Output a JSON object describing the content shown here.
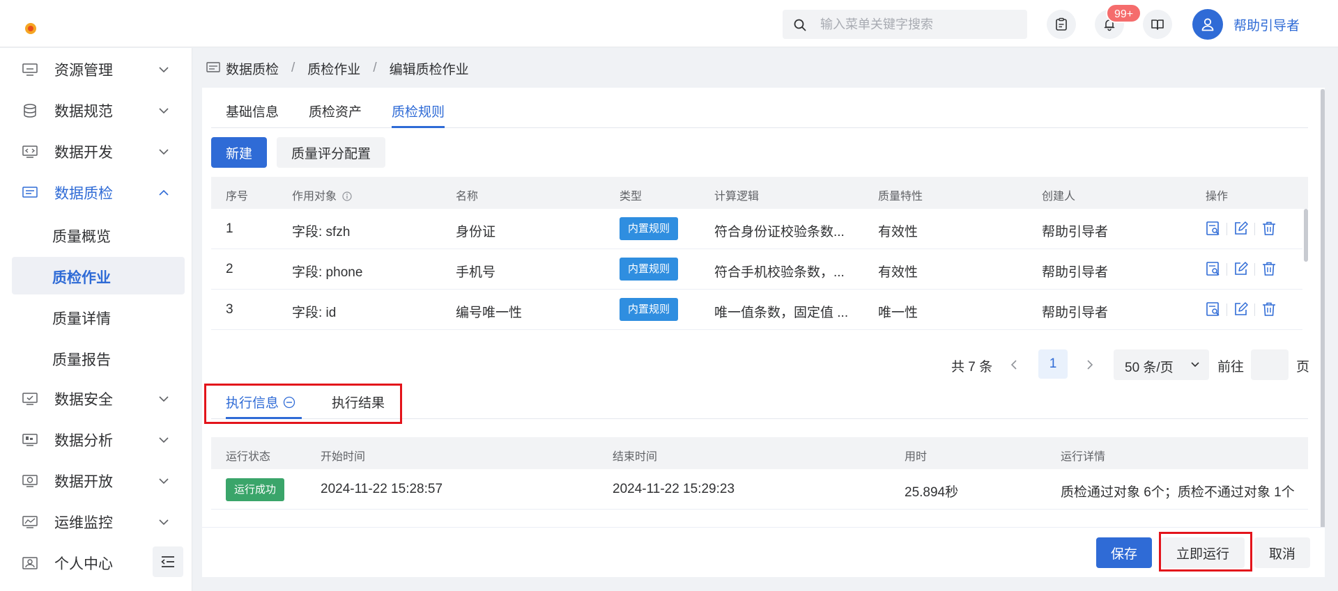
{
  "header": {
    "search_placeholder": "输入菜单关键字搜索",
    "notification_badge": "99+",
    "user_name": "帮助引导者"
  },
  "sidebar": {
    "items": [
      {
        "label": "资源管理"
      },
      {
        "label": "数据规范"
      },
      {
        "label": "数据开发"
      },
      {
        "label": "数据质检",
        "expanded": true
      },
      {
        "label": "数据安全"
      },
      {
        "label": "数据分析"
      },
      {
        "label": "数据开放"
      },
      {
        "label": "运维监控"
      },
      {
        "label": "个人中心"
      }
    ],
    "subitems": [
      {
        "label": "质量概览"
      },
      {
        "label": "质检作业",
        "active": true
      },
      {
        "label": "质量详情"
      },
      {
        "label": "质量报告"
      }
    ]
  },
  "breadcrumb": {
    "items": [
      "数据质检",
      "质检作业",
      "编辑质检作业"
    ],
    "separator": "/"
  },
  "tabs": {
    "items": [
      "基础信息",
      "质检资产",
      "质检规则"
    ],
    "active_index": 2
  },
  "toolbar": {
    "new_label": "新建",
    "score_config_label": "质量评分配置"
  },
  "rules_table": {
    "columns": [
      "序号",
      "作用对象",
      "名称",
      "类型",
      "计算逻辑",
      "质量特性",
      "创建人",
      "操作"
    ],
    "rows": [
      {
        "index": "1",
        "target": "字段: sfzh",
        "name": "身份证",
        "type": "内置规则",
        "logic": "符合身份证校验条数...",
        "quality": "有效性",
        "creator": "帮助引导者"
      },
      {
        "index": "2",
        "target": "字段: phone",
        "name": "手机号",
        "type": "内置规则",
        "logic": "符合手机校验条数，...",
        "quality": "有效性",
        "creator": "帮助引导者"
      },
      {
        "index": "3",
        "target": "字段: id",
        "name": "编号唯一性",
        "type": "内置规则",
        "logic": "唯一值条数，固定值 ...",
        "quality": "唯一性",
        "creator": "帮助引导者"
      }
    ]
  },
  "pagination": {
    "total_text": "共 7 条",
    "current_page": "1",
    "page_size": "50 条/页",
    "goto_label": "前往",
    "page_unit": "页"
  },
  "exec_tabs": {
    "items": [
      "执行信息",
      "执行结果"
    ],
    "active_index": 0
  },
  "exec_table": {
    "columns": [
      "运行状态",
      "开始时间",
      "结束时间",
      "用时",
      "运行详情"
    ],
    "rows": [
      {
        "status": "运行成功",
        "start": "2024-11-22 15:28:57",
        "end": "2024-11-22 15:29:23",
        "duration": "25.894秒",
        "detail": "质检通过对象 6个；质检不通过对象 1个"
      }
    ]
  },
  "footer": {
    "save_label": "保存",
    "run_label": "立即运行",
    "cancel_label": "取消"
  },
  "colors": {
    "primary": "#2f6bd6",
    "tag_blue": "#2f8ee0",
    "tag_green": "#3aa56a",
    "badge_red": "#f56c6c",
    "highlight_red": "#e3141b"
  }
}
